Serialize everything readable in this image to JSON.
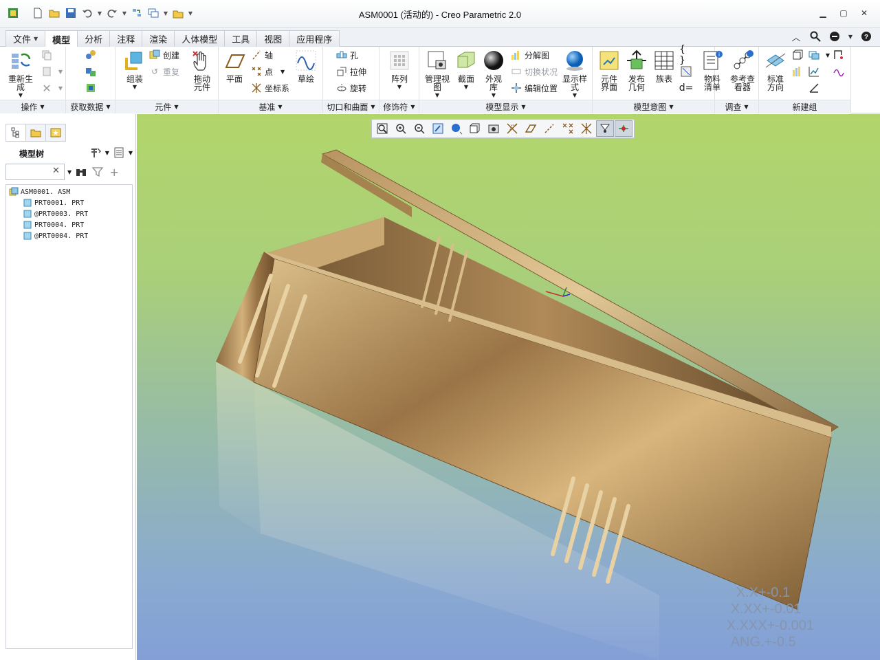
{
  "window": {
    "title": "ASM0001 (活动的) - Creo Parametric 2.0"
  },
  "tabs": [
    {
      "label": "文件",
      "dropdown": true
    },
    {
      "label": "模型",
      "active": true
    },
    {
      "label": "分析"
    },
    {
      "label": "注释"
    },
    {
      "label": "渲染"
    },
    {
      "label": "人体模型"
    },
    {
      "label": "工具"
    },
    {
      "label": "视图"
    },
    {
      "label": "应用程序"
    }
  ],
  "ribbon": {
    "operations": {
      "label": "操作",
      "regenerate": "重新生成"
    },
    "get_data": {
      "label": "获取数据"
    },
    "components": {
      "label": "元件",
      "assemble": "组装",
      "create": "创建",
      "repeat": "重复",
      "drag": "拖动元件"
    },
    "datum": {
      "label": "基准",
      "plane": "平面",
      "axis": "轴",
      "point": "点",
      "csys": "坐标系",
      "sketch": "草绘"
    },
    "cut_surface": {
      "label": "切口和曲面",
      "hole": "孔",
      "extrude": "拉伸",
      "revolve": "旋转"
    },
    "modifiers": {
      "label": "修饰符",
      "pattern": "阵列"
    },
    "model_display": {
      "label": "模型显示",
      "manage_views": "管理视图",
      "section": "截面",
      "appearance": "外观库",
      "explode": "分解图",
      "toggle_status": "切换状况",
      "edit_position": "编辑位置",
      "display_style": "显示样式"
    },
    "model_intent": {
      "label": "模型意图",
      "component_interface": "元件界面",
      "publish_geometry": "发布几何",
      "family_table": "族表"
    },
    "investigate": {
      "label": "调查",
      "bom": "物料清单",
      "reference_viewer": "参考查看器"
    },
    "new_group": {
      "label": "新建组",
      "normal_orientation": "标准方向"
    }
  },
  "model_tree": {
    "title": "模型树",
    "filter_value": "",
    "items": [
      {
        "name": "ASM0001. ASM",
        "level": 0,
        "type": "assembly"
      },
      {
        "name": "PRT0001. PRT",
        "level": 1,
        "type": "part"
      },
      {
        "name": "@PRT0003. PRT",
        "level": 1,
        "type": "part"
      },
      {
        "name": "PRT0004. PRT",
        "level": 1,
        "type": "part"
      },
      {
        "name": "@PRT0004. PRT",
        "level": 1,
        "type": "part"
      }
    ]
  },
  "viewport": {
    "tolerances": [
      "X.X+-0.1",
      "X.XX+-0.01",
      "X.XXX+-0.001",
      "ANG.+-0.5"
    ],
    "colors": {
      "model": "#b8915a",
      "background_top": "#b2d56b",
      "background_bottom": "#839fd6"
    }
  }
}
